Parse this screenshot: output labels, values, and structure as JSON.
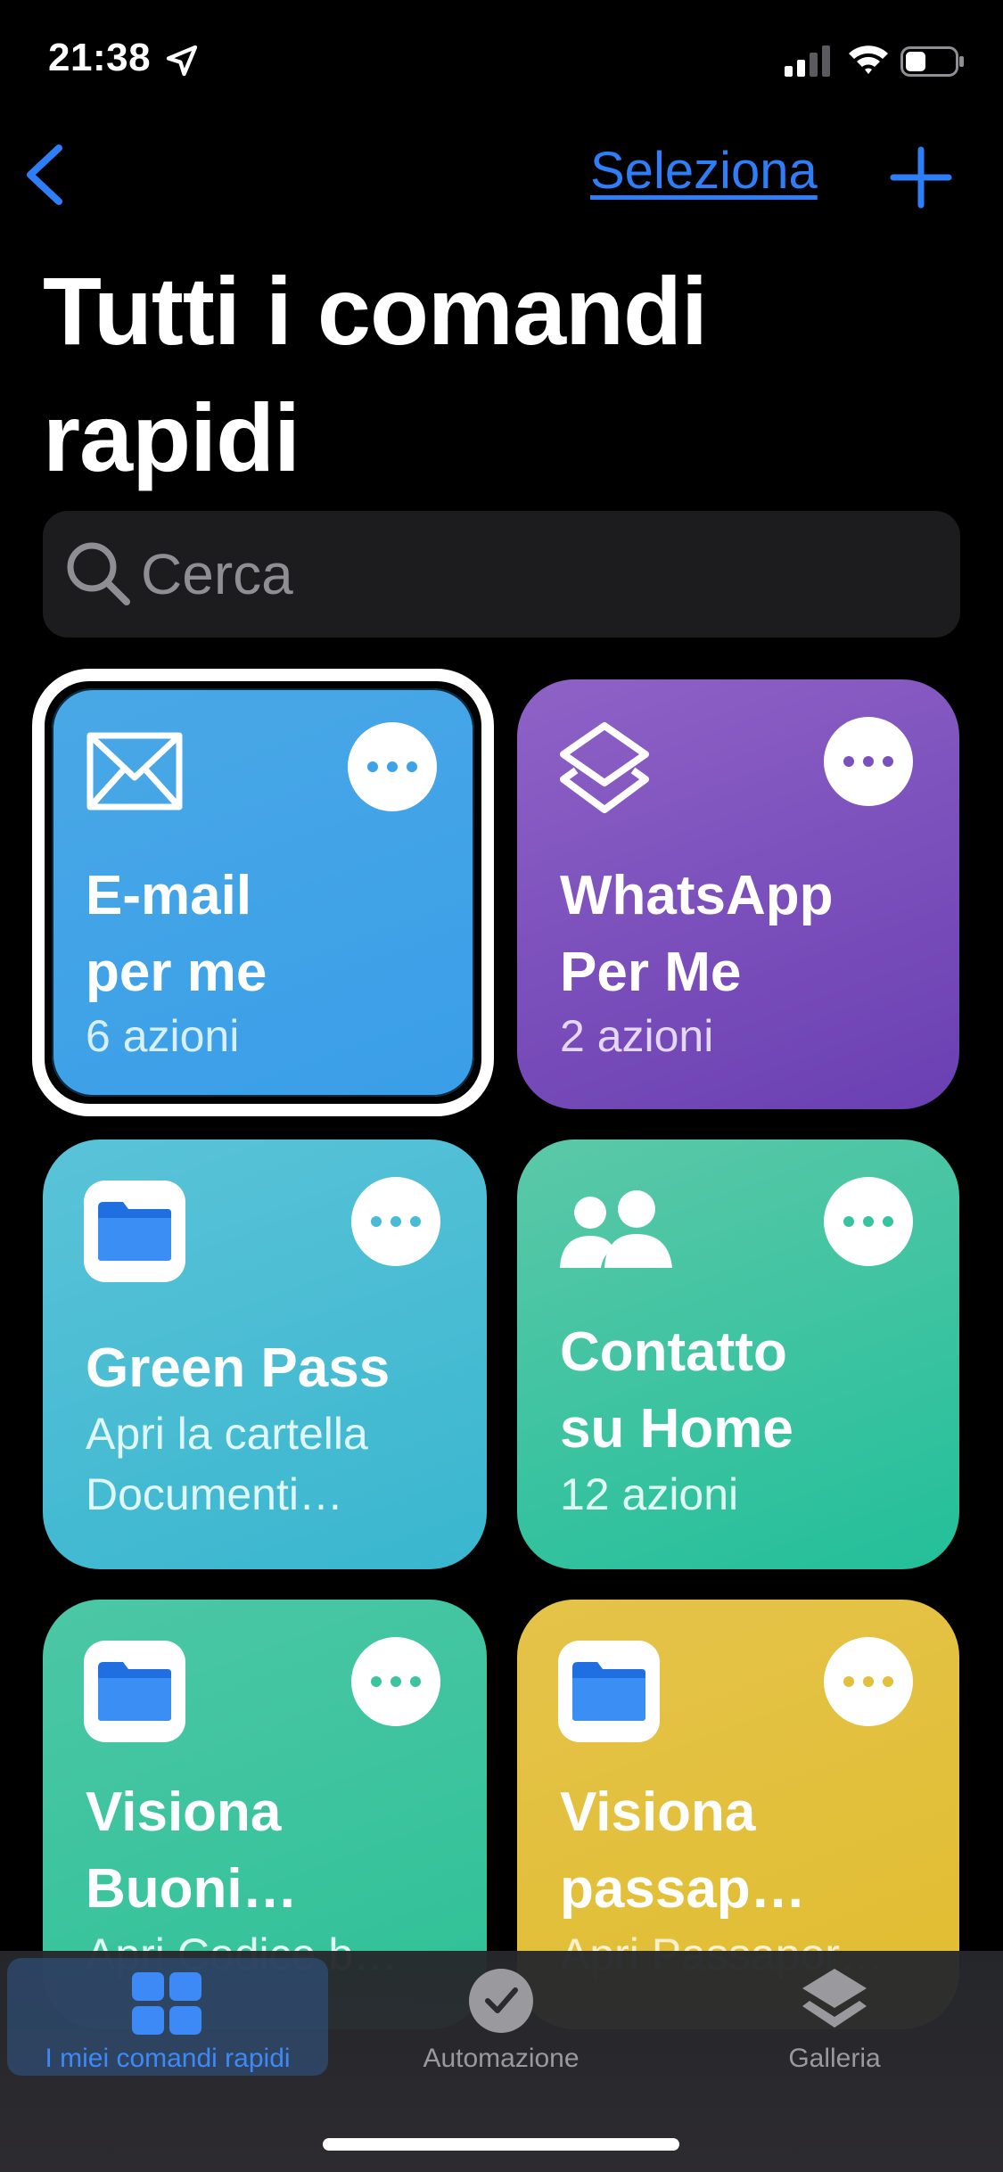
{
  "status_bar": {
    "time": "21:38"
  },
  "nav": {
    "select_label": "Seleziona"
  },
  "page": {
    "title": "Tutti i comandi rapidi"
  },
  "search": {
    "placeholder": "Cerca"
  },
  "tiles": [
    {
      "name": "E-mail\nper me",
      "subtitle": "6 azioni",
      "icon": "envelope-icon",
      "color": "#3DA3E8",
      "selected": true
    },
    {
      "name": "WhatsApp\nPer Me",
      "subtitle": "2 azioni",
      "icon": "layers-icon",
      "color": "#7A50BD"
    },
    {
      "name": "Green Pass",
      "subtitle": "Apri la cartella\nDocumenti…",
      "icon": "folder-icon",
      "color": "#47BCD4"
    },
    {
      "name": "Contatto\nsu Home",
      "subtitle": "12 azioni",
      "icon": "people-icon",
      "color": "#38C3A0"
    },
    {
      "name": "Visiona\nBuoni…",
      "subtitle": "Apri Codice b…",
      "icon": "folder-icon",
      "color": "#3CC49E"
    },
    {
      "name": "Visiona\npassap…",
      "subtitle": "Apri Passapor…",
      "icon": "folder-icon",
      "color": "#E2C03B"
    }
  ],
  "tab_bar": {
    "tabs": [
      {
        "label": "I miei comandi rapidi",
        "icon": "grid-icon",
        "active": true
      },
      {
        "label": "Automazione",
        "icon": "clock-check-icon",
        "active": false
      },
      {
        "label": "Galleria",
        "icon": "layers-icon",
        "active": false
      }
    ]
  },
  "colors": {
    "accent": "#2E7EF7",
    "background": "#000000"
  }
}
